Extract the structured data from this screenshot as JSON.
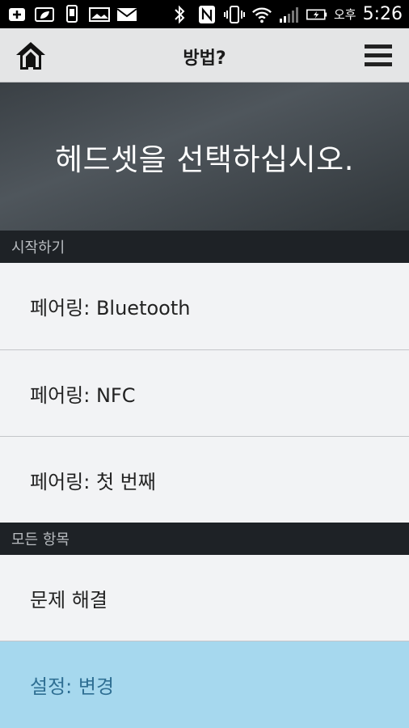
{
  "status_bar": {
    "ampm": "오후",
    "time": "5:26"
  },
  "app_bar": {
    "title": "방법?"
  },
  "hero": {
    "title": "헤드셋을 선택하십시오."
  },
  "sections": {
    "getting_started": {
      "header": "시작하기",
      "items": [
        "페어링: Bluetooth",
        "페어링: NFC",
        "페어링: 첫 번째"
      ]
    },
    "all_items": {
      "header": "모든 항목",
      "items": [
        "문제 해결",
        "설정: 변경"
      ]
    }
  },
  "colors": {
    "selected_bg": "#a6d8ee",
    "selected_text": "#2f6f93",
    "header_bg": "#1e2226"
  }
}
